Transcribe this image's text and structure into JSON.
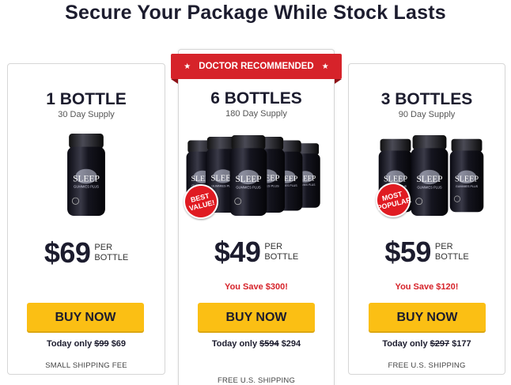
{
  "headline": "Secure Your Package While Stock Lasts",
  "ribbon": {
    "label": "DOCTOR RECOMMENDED",
    "star": "★"
  },
  "colors": {
    "ribbon": "#d6232a",
    "button": "#fbbf14",
    "save_text": "#d6232a",
    "badge": "#e01b22"
  },
  "product_label": {
    "line1": "SLEEP",
    "line2": "GUMMIES PLUS"
  },
  "packages": [
    {
      "title": "1 BOTTLE",
      "supply": "30 Day Supply",
      "price": "$69",
      "per_line1": "PER",
      "per_line2": "BOTTLE",
      "save": "",
      "button": "BUY NOW",
      "today_prefix": "Today only",
      "old_price": "$99",
      "new_price": "$69",
      "shipping": "SMALL SHIPPING FEE",
      "badge": ""
    },
    {
      "title": "6 BOTTLES",
      "supply": "180 Day Supply",
      "price": "$49",
      "per_line1": "PER",
      "per_line2": "BOTTLE",
      "save": "You Save $300!",
      "button": "BUY NOW",
      "today_prefix": "Today only",
      "old_price": "$594",
      "new_price": "$294",
      "shipping": "FREE U.S. SHIPPING",
      "badge_line1": "BEST",
      "badge_line2": "VALUE!"
    },
    {
      "title": "3 BOTTLES",
      "supply": "90 Day Supply",
      "price": "$59",
      "per_line1": "PER",
      "per_line2": "BOTTLE",
      "save": "You Save $120!",
      "button": "BUY NOW",
      "today_prefix": "Today only",
      "old_price": "$297",
      "new_price": "$177",
      "shipping": "FREE U.S. SHIPPING",
      "badge_line1": "MOST",
      "badge_line2": "POPULAR"
    }
  ]
}
